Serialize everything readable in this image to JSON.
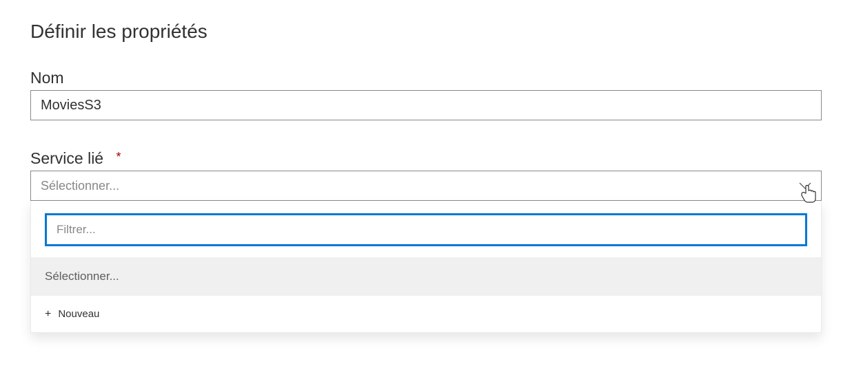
{
  "section": {
    "title": "Définir les propriétés"
  },
  "fields": {
    "name": {
      "label": "Nom",
      "value": "MoviesS3"
    },
    "linkedService": {
      "label": "Service lié",
      "required": "*",
      "placeholder": "Sélectionner..."
    }
  },
  "dropdown": {
    "filterPlaceholder": "Filtrer...",
    "selectOption": "Sélectionner...",
    "newLabel": "Nouveau"
  }
}
